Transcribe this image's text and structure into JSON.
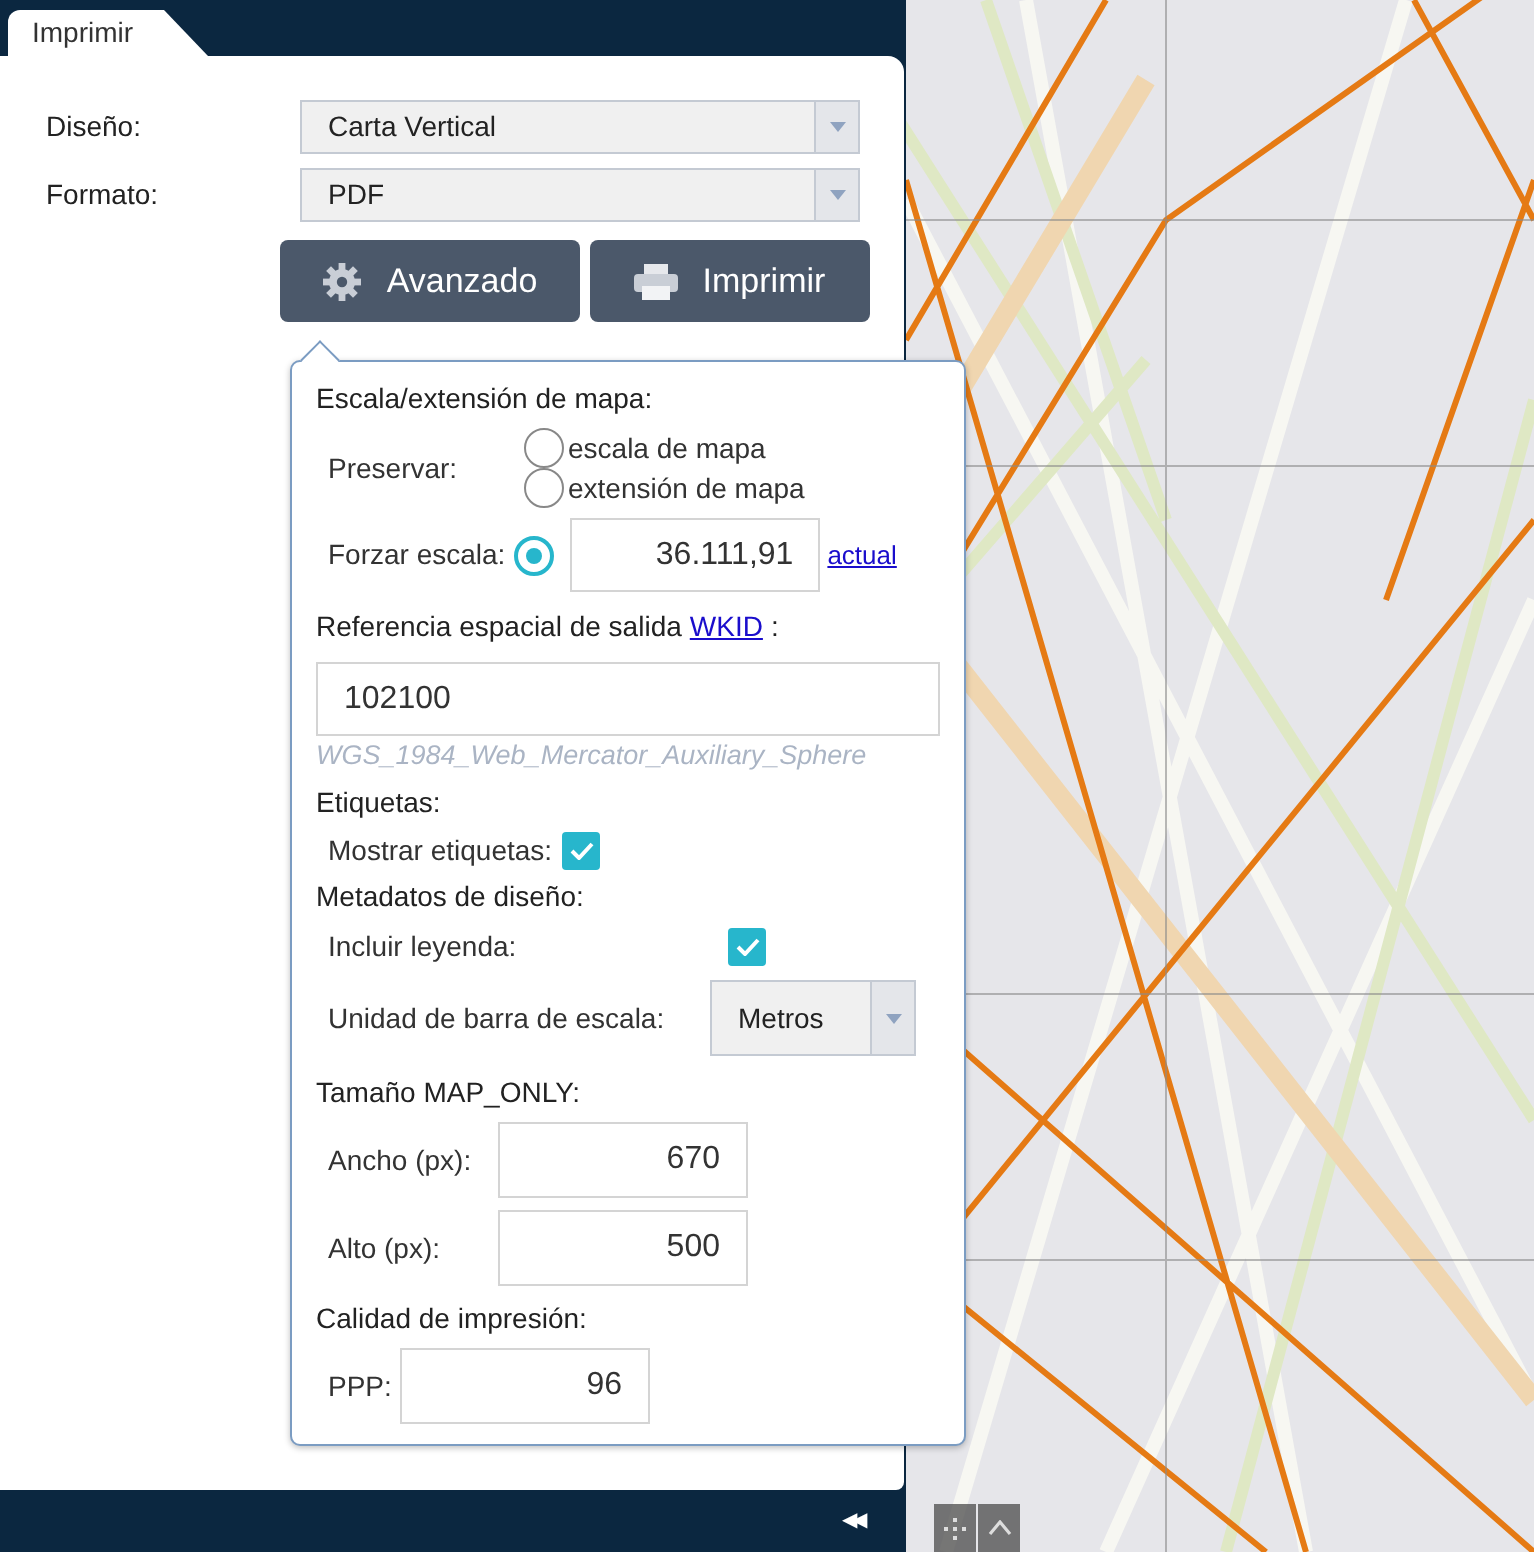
{
  "tab": {
    "label": "Imprimir",
    "selected": true
  },
  "fields": [
    {
      "label": "Diseño:",
      "value": "Carta Vertical"
    },
    {
      "label": "Formato:",
      "value": "PDF"
    }
  ],
  "buttons": [
    {
      "kind": "settings",
      "label": "Avanzado"
    },
    {
      "kind": "print",
      "label": "Imprimir"
    }
  ],
  "advanced": {
    "scale_heading": "Escala/extensión de mapa:",
    "preserve_label": "Preservar:",
    "preserve_options": [
      {
        "label": "escala de mapa",
        "selected": false
      },
      {
        "label": "extensión de mapa",
        "selected": false
      }
    ],
    "force_scale": {
      "label": "Forzar escala:",
      "selected": true,
      "value": "36.111,91",
      "link": "actual"
    },
    "sr_heading": "Referencia espacial de salida",
    "sr_link": "WKID",
    "sr_suffix": ":",
    "wkid": "102100",
    "wkid_name": "WGS_1984_Web_Mercator_Auxiliary_Sphere",
    "labels_heading": "Etiquetas:",
    "show_labels": {
      "label": "Mostrar etiquetas:",
      "checked": true
    },
    "layout_heading": "Metadatos de diseño:",
    "include_legend": {
      "label": "Incluir leyenda:",
      "checked": true
    },
    "scalebar_unit": {
      "label": "Unidad de barra de escala:",
      "value": "Metros"
    },
    "map_only_heading": "Tamaño MAP_ONLY:",
    "width": {
      "label": "Ancho (px):",
      "value": "670"
    },
    "height": {
      "label": "Alto (px):",
      "value": "500"
    },
    "quality_heading": "Calidad de impresión:",
    "dpi": {
      "label": "PPP:",
      "value": "96"
    }
  },
  "collapse_glyph": "◀◀"
}
